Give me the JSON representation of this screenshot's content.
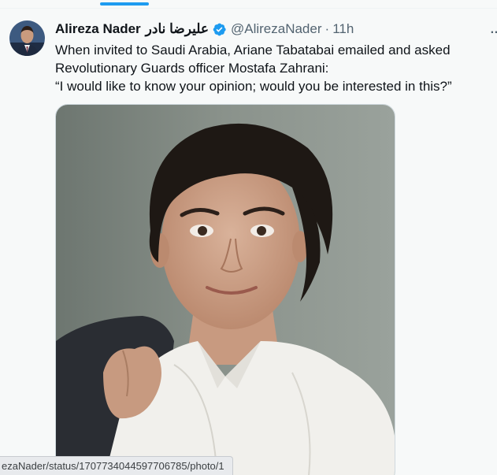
{
  "tweet": {
    "author": {
      "display_name": "Alireza Nader",
      "arabic_name": "علیرضا نادر",
      "verified_icon": "verified-badge-icon",
      "handle": "@AlirezaNader",
      "separator": "·",
      "time": "11h",
      "avatar": "avatar-photo"
    },
    "text_lines": [
      "When invited to Saudi Arabia, Ariane Tabatabai emailed and asked",
      "Revolutionary Guards officer Mostafa Zahrani:",
      "“I would like to know your opinion; would you be interested in this?”"
    ],
    "photo": "woman-portrait-photo"
  },
  "status_bar": {
    "url": "ezaNader/status/1707734044597706785/photo/1"
  },
  "colors": {
    "accent": "#1d9bf0",
    "text": "#0f1419",
    "secondary": "#536471",
    "background": "#f7f9f9"
  },
  "icons": {
    "more": "more-icon"
  }
}
